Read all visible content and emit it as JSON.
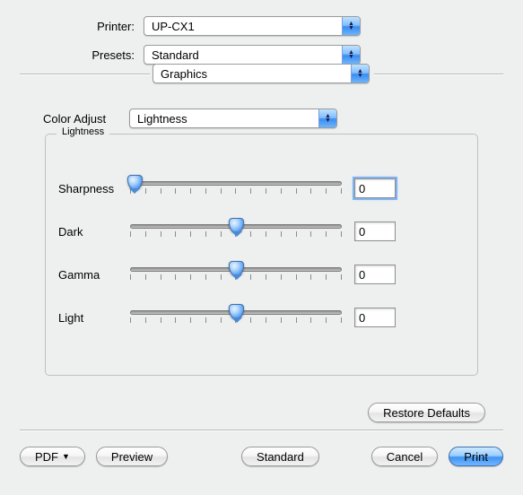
{
  "header": {
    "printer_label": "Printer:",
    "printer_value": "UP-CX1",
    "presets_label": "Presets:",
    "presets_value": "Standard"
  },
  "pane_selector": "Graphics",
  "color_adjust": {
    "label": "Color Adjust",
    "value": "Lightness"
  },
  "fieldset_legend": "Lightness",
  "sliders": {
    "sharpness": {
      "label": "Sharpness",
      "value": "0",
      "pos_pct": 2
    },
    "dark": {
      "label": "Dark",
      "value": "0",
      "pos_pct": 50
    },
    "gamma": {
      "label": "Gamma",
      "value": "0",
      "pos_pct": 50
    },
    "light": {
      "label": "Light",
      "value": "0",
      "pos_pct": 50
    }
  },
  "buttons": {
    "restore_defaults": "Restore Defaults",
    "pdf": "PDF",
    "preview": "Preview",
    "standard": "Standard",
    "cancel": "Cancel",
    "print": "Print"
  }
}
